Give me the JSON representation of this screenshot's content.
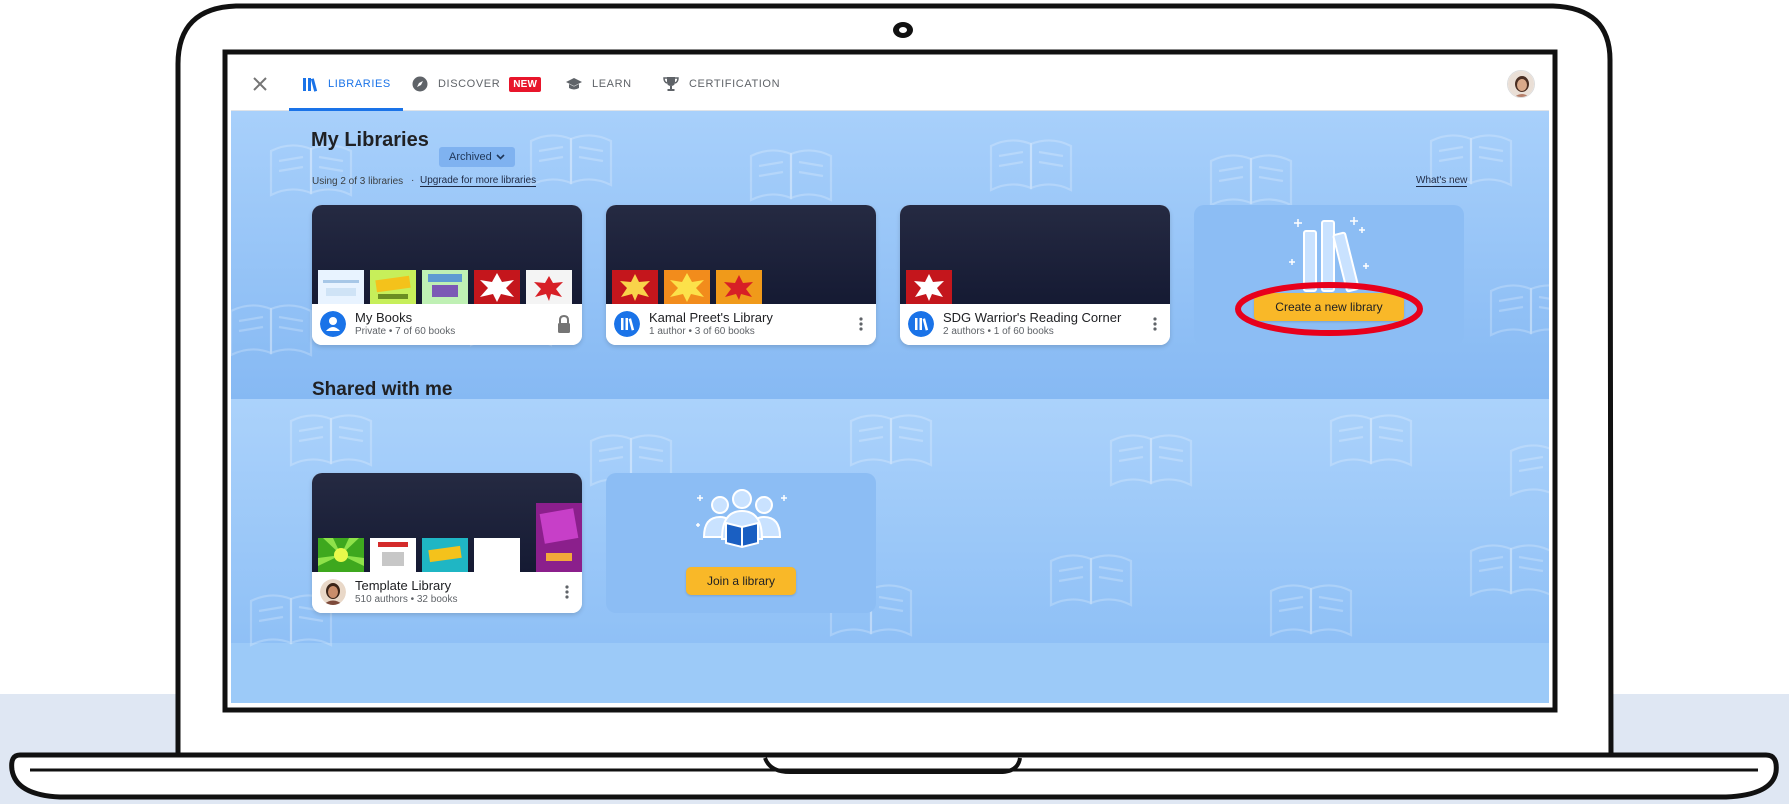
{
  "nav": {
    "items": [
      {
        "label": "LIBRARIES",
        "icon": "books-icon",
        "active": true
      },
      {
        "label": "DISCOVER",
        "icon": "compass-icon",
        "badge": "NEW"
      },
      {
        "label": "LEARN",
        "icon": "graduation-cap-icon"
      },
      {
        "label": "CERTIFICATION",
        "icon": "trophy-icon"
      }
    ]
  },
  "my_libraries": {
    "title": "My Libraries",
    "archived_label": "Archived",
    "usage": "Using 2 of 3 libraries",
    "upgrade_link": "Upgrade for more libraries",
    "whats_new": "What's new",
    "cards": [
      {
        "title": "My Books",
        "subtitle": "Private • 7 of 60 books"
      },
      {
        "title": "Kamal Preet's Library",
        "subtitle": "1 author • 3 of 60 books"
      },
      {
        "title": "SDG Warrior's Reading Corner",
        "subtitle": "2 authors • 1 of 60 books"
      }
    ],
    "create_button": "Create a new library"
  },
  "shared": {
    "title": "Shared with me",
    "cards": [
      {
        "title": "Template Library",
        "subtitle": "510 authors • 32 books"
      }
    ],
    "join_button": "Join a library"
  },
  "colors": {
    "accent": "#1a73e8",
    "badge": "#e8152b",
    "cta": "#f9b828",
    "highlight_ring": "#e8001c"
  }
}
